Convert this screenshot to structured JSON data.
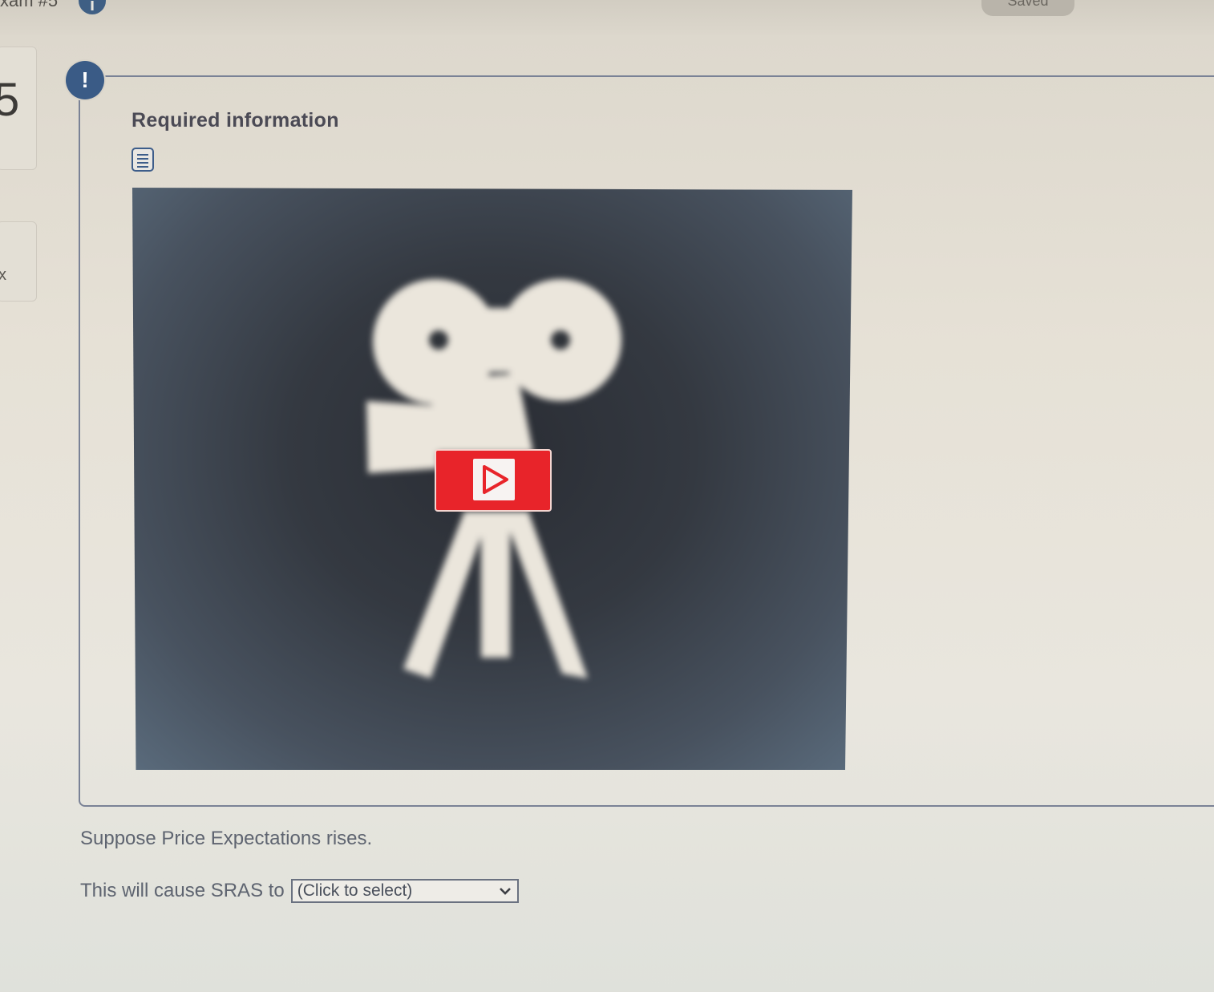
{
  "header": {
    "title": "xam #5",
    "info_icon": "info-icon",
    "saved_label": "Saved"
  },
  "nav": {
    "current_number": "5",
    "mark": "x"
  },
  "panel": {
    "alert_icon_glyph": "!",
    "title": "Required information",
    "doc_icon": "document-icon",
    "video": {
      "thumbnail_icon": "movie-camera-icon",
      "play_icon": "play-icon",
      "play_color": "#e8242a"
    }
  },
  "question": {
    "prompt": "Suppose Price Expectations rises.",
    "answer_prefix": "This will cause SRAS to",
    "select_value": "(Click to select)"
  },
  "colors": {
    "accent": "#3a5b86",
    "play": "#e8242a",
    "text": "#5e6470"
  }
}
